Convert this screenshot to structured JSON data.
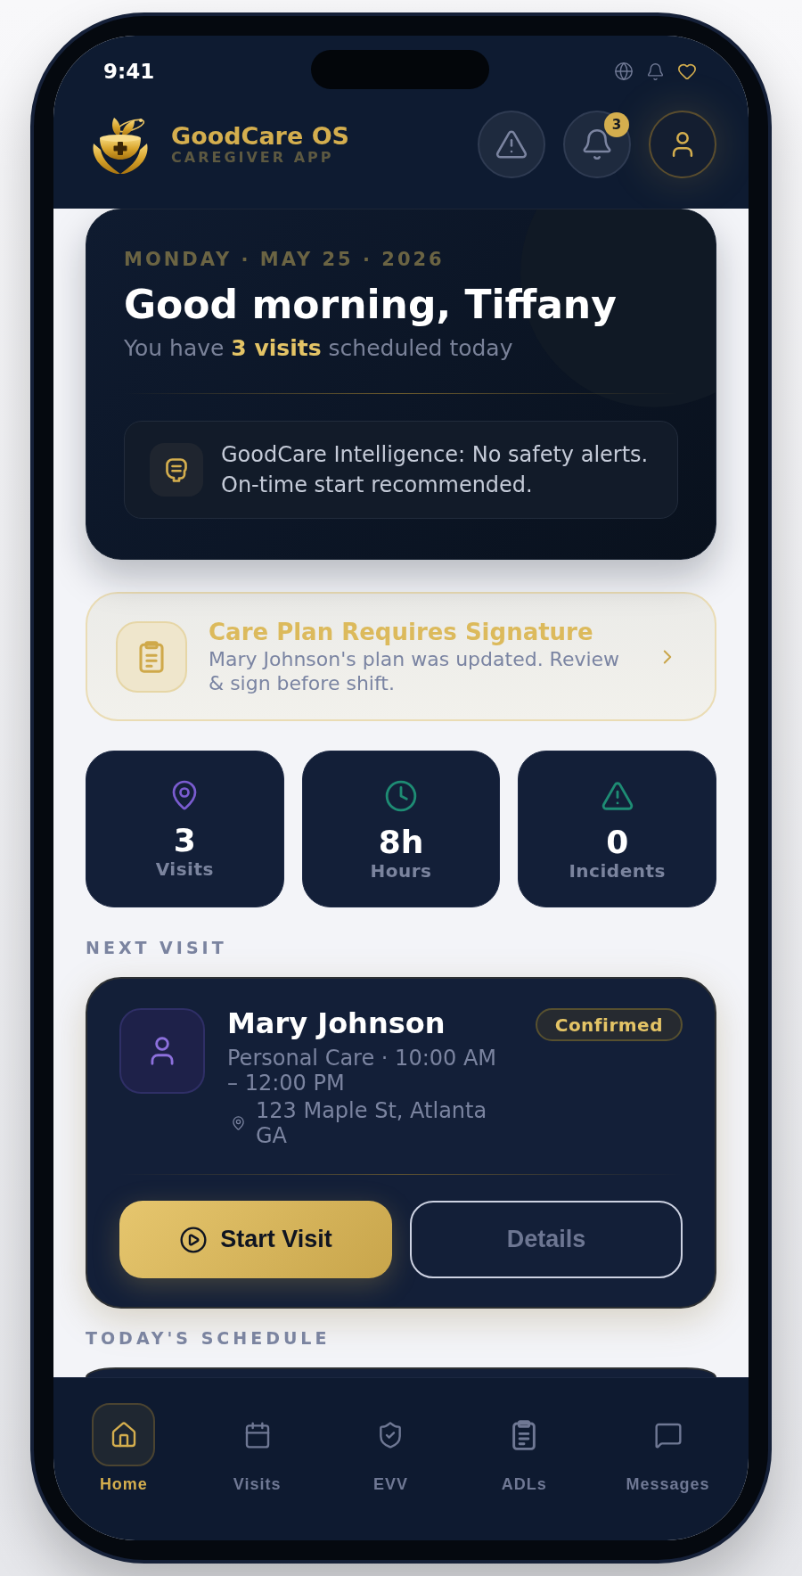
{
  "status_bar": {
    "time": "9:41"
  },
  "header": {
    "app_name": "GoodCare OS",
    "app_subtitle": "CAREGIVER APP",
    "notification_count": "3"
  },
  "greeting": {
    "date": "MONDAY · MAY 25 · 2026",
    "title": "Good morning, Tiffany",
    "subtitle": "You have **3 visits** scheduled today",
    "insight": "GoodCare Intelligence: No safety alerts. On-time start recommended."
  },
  "care_plan_alert": {
    "title": "Care Plan Requires Signature",
    "message": "Mary Johnson's plan was updated. Review & sign before shift."
  },
  "stats": [
    {
      "kind": "visits",
      "value": "3",
      "label": "Visits"
    },
    {
      "kind": "hours",
      "value": "8h",
      "label": "Hours"
    },
    {
      "kind": "incidents",
      "value": "0",
      "label": "Incidents"
    }
  ],
  "next_visit": {
    "heading": "NEXT VISIT",
    "client": "Mary Johnson",
    "service": "Personal Care · 10:00 AM – 12:00 PM",
    "address": "123 Maple St, Atlanta GA",
    "status": "Confirmed",
    "actions": [
      {
        "kind": "primary",
        "label": "Start Visit"
      },
      {
        "kind": "secondary",
        "label": "Details"
      }
    ]
  },
  "schedule": {
    "heading": "TODAY'S SCHEDULE"
  },
  "bottom_nav": [
    {
      "kind": "home",
      "label": "Home",
      "selected": true
    },
    {
      "kind": "visits",
      "label": "Visits",
      "selected": false
    },
    {
      "kind": "evv",
      "label": "EVV",
      "selected": false
    },
    {
      "kind": "adls",
      "label": "ADLs",
      "selected": false
    },
    {
      "kind": "messages",
      "label": "Messages",
      "selected": false
    }
  ]
}
